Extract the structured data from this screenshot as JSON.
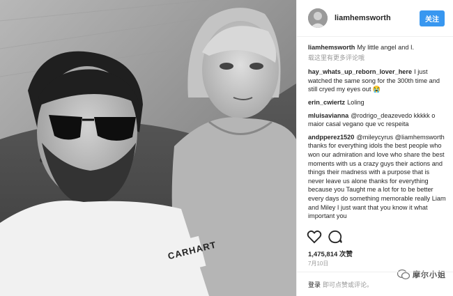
{
  "post": {
    "username": "liamhemsworth",
    "follow_label": "关注",
    "caption": "My little angel and I.",
    "view_more": "载这里有更多评论哦",
    "comments": [
      {
        "user": "hay_whats_up_reborn_lover_here",
        "text": "I just watched the same song for the 300th time and still cryed my eyes out 😭"
      },
      {
        "user": "erin_cwiertz",
        "text": "Loling"
      },
      {
        "user": "mluisavianna",
        "text": "@rodrigo_deazevedo kkkkk o maior casal vegano que vc respeita"
      },
      {
        "user": "andpperez1520",
        "text": "@mileycyrus @liamhemsworth thanks for everything idols the best people who won our admiration and love who share the best moments with us a crazy guys their actions and things their madness with a purpose that is never leave us alone thanks for everything because you Taught me a lot for to be better every days do something memorable really Liam and Miley I just want that you know it what important you"
      }
    ],
    "likes": "1,475,814 次赞",
    "date": "7月10日"
  },
  "footer": {
    "login_label": "登录",
    "after_login": "即可点赞或评论。"
  },
  "watermark": {
    "text": "摩尔小姐"
  },
  "photo": {
    "shirt_text": "CARHART"
  }
}
